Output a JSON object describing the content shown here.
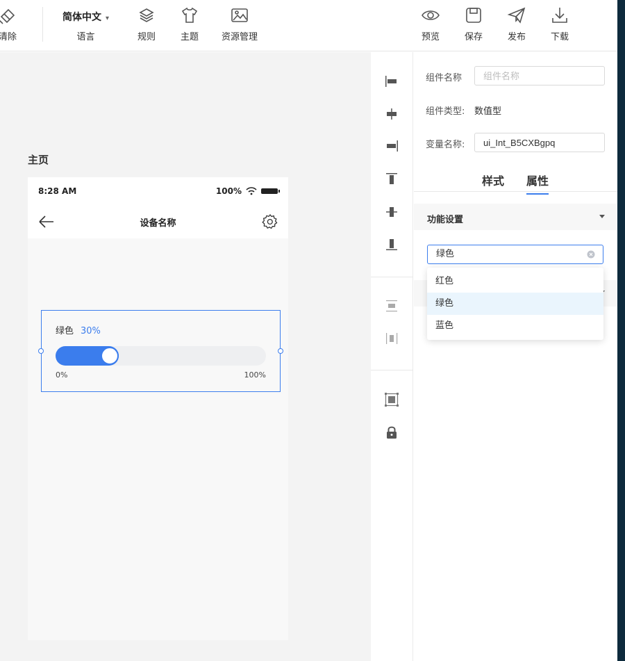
{
  "toolbar": {
    "clear_label": "清除",
    "language_value": "简体中文",
    "language_label": "语言",
    "rules_label": "规则",
    "theme_label": "主题",
    "resources_label": "资源管理",
    "preview_label": "预览",
    "save_label": "保存",
    "publish_label": "发布",
    "download_label": "下载"
  },
  "canvas": {
    "page_title": "主页",
    "phone": {
      "time": "8:28 AM",
      "battery": "100%",
      "nav_title": "设备名称"
    },
    "slider": {
      "label": "绿色",
      "percent_text": "30%",
      "value": 0.3,
      "min_label": "0%",
      "max_label": "100%",
      "accent": "#3b7ded"
    }
  },
  "panel": {
    "component_name_label": "组件名称",
    "component_name_placeholder": "组件名称",
    "component_type_label": "组件类型:",
    "component_type_value": "数值型",
    "variable_name_label": "变量名称:",
    "variable_name_value": "ui_Int_B5CXBgpq",
    "tabs": [
      {
        "label": "样式",
        "active": false
      },
      {
        "label": "属性",
        "active": true
      }
    ],
    "section_title": "功能设置",
    "color_select_value": "绿色",
    "color_options": [
      "红色",
      "绿色",
      "蓝色"
    ],
    "selected_option": "绿色"
  },
  "icons": {
    "toolbar": [
      "clear-icon",
      "layers-icon",
      "tshirt-icon",
      "image-icon",
      "eye-icon",
      "save-icon",
      "send-icon",
      "download-icon"
    ],
    "align": [
      "align-left-icon",
      "align-hcenter-icon",
      "align-right-icon",
      "align-top-icon",
      "align-vcenter-icon",
      "align-bottom-icon",
      "distribute-vertical-icon",
      "distribute-horizontal-icon",
      "group-icon",
      "lock-icon"
    ]
  }
}
